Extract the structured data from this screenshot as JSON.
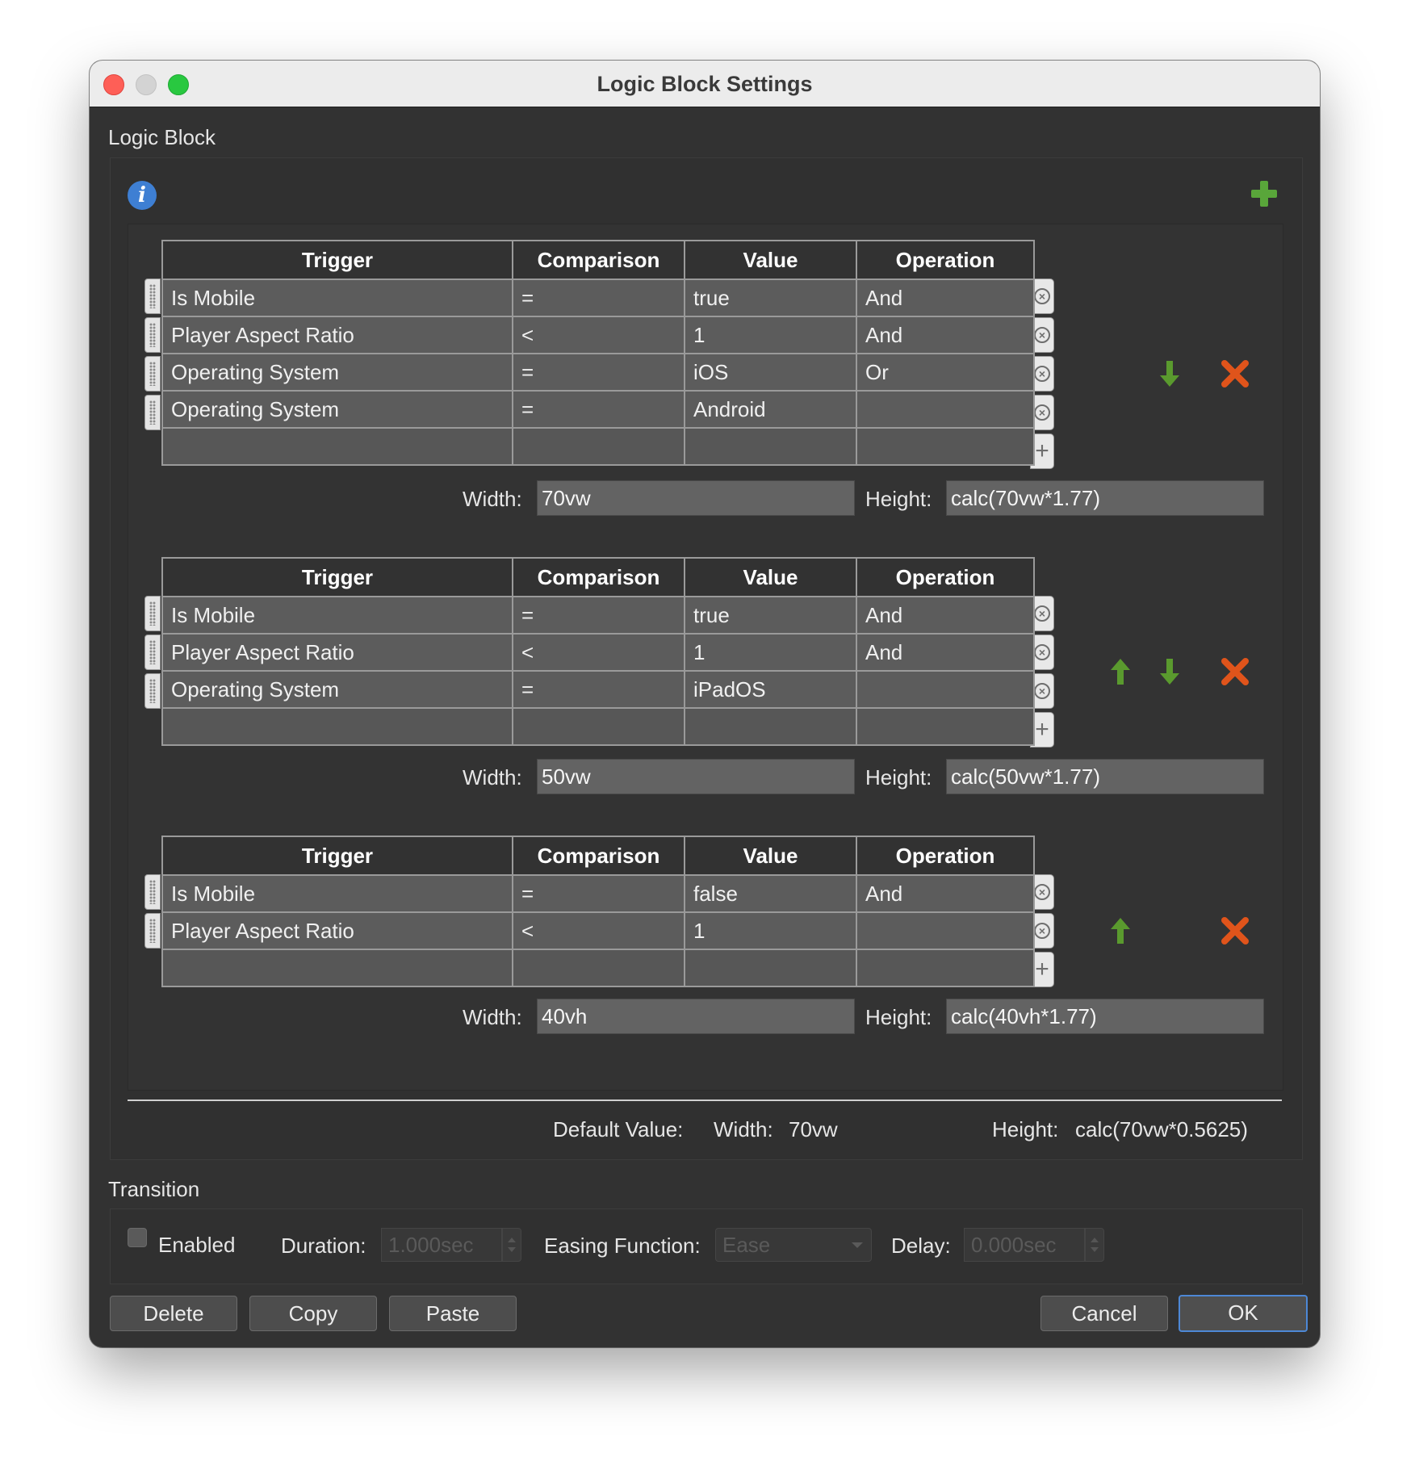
{
  "window": {
    "title": "Logic Block Settings"
  },
  "logic_block": {
    "section_label": "Logic Block",
    "columns": [
      "Trigger",
      "Comparison",
      "Value",
      "Operation"
    ],
    "width_label": "Width:",
    "height_label": "Height:",
    "blocks": [
      {
        "rows": [
          {
            "trigger": "Is Mobile",
            "comparison": "=",
            "value": "true",
            "operation": "And"
          },
          {
            "trigger": "Player Aspect Ratio",
            "comparison": "<",
            "value": "1",
            "operation": "And"
          },
          {
            "trigger": "Operating System",
            "comparison": "=",
            "value": "iOS",
            "operation": "Or"
          },
          {
            "trigger": "Operating System",
            "comparison": "=",
            "value": "Android",
            "operation": ""
          }
        ],
        "width": "70vw",
        "height": "calc(70vw*1.77)"
      },
      {
        "rows": [
          {
            "trigger": "Is Mobile",
            "comparison": "=",
            "value": "true",
            "operation": "And"
          },
          {
            "trigger": "Player Aspect Ratio",
            "comparison": "<",
            "value": "1",
            "operation": "And"
          },
          {
            "trigger": "Operating System",
            "comparison": "=",
            "value": "iPadOS",
            "operation": ""
          }
        ],
        "width": "50vw",
        "height": "calc(50vw*1.77)"
      },
      {
        "rows": [
          {
            "trigger": "Is Mobile",
            "comparison": "=",
            "value": "false",
            "operation": "And"
          },
          {
            "trigger": "Player Aspect Ratio",
            "comparison": "<",
            "value": "1",
            "operation": ""
          }
        ],
        "width": "40vh",
        "height": "calc(40vh*1.77)"
      }
    ],
    "default_value": {
      "label": "Default Value:",
      "width_label": "Width:",
      "width": "70vw",
      "height_label": "Height:",
      "height": "calc(70vw*0.5625)"
    }
  },
  "transition": {
    "section_label": "Transition",
    "enabled_label": "Enabled",
    "enabled": false,
    "duration_label": "Duration:",
    "duration": "1.000sec",
    "easing_label": "Easing Function:",
    "easing": "Ease",
    "delay_label": "Delay:",
    "delay": "0.000sec"
  },
  "buttons": {
    "delete": "Delete",
    "copy": "Copy",
    "paste": "Paste",
    "cancel": "Cancel",
    "ok": "OK"
  },
  "colors": {
    "arrow_green": "#5a9a2e",
    "delete_orange": "#e0541b",
    "accent_blue": "#4d88d6",
    "info_blue": "#3e7fd3",
    "add_green": "#59a63a"
  },
  "icons": {
    "info": "i",
    "add_row": "+",
    "remove_row": "×"
  }
}
